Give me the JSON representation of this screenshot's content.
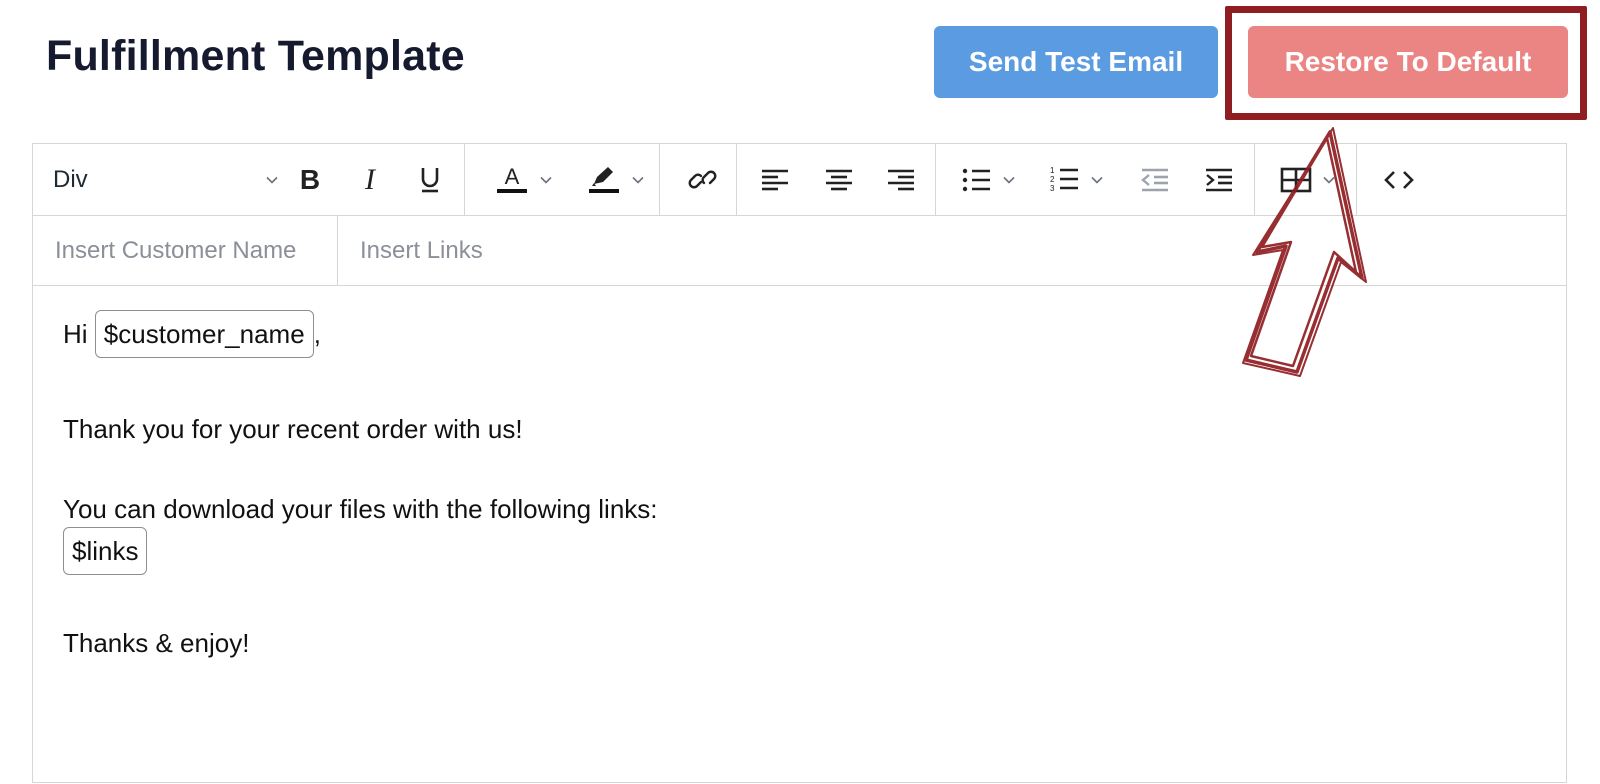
{
  "page": {
    "title": "Fulfillment Template"
  },
  "header_buttons": {
    "send_test_email": "Send Test Email",
    "restore_default": "Restore To Default"
  },
  "colors": {
    "send_button": "#5b9be1",
    "restore_button": "#eb8584",
    "annotation": "#8f1d21"
  },
  "toolbar": {
    "format_select_value": "Div",
    "icons": [
      "bold-icon",
      "italic-icon",
      "underline-icon",
      "text-color-icon",
      "highlight-color-icon",
      "link-icon",
      "align-left-icon",
      "align-center-icon",
      "align-right-icon",
      "bullet-list-icon",
      "numbered-list-icon",
      "outdent-icon",
      "indent-icon",
      "table-icon",
      "code-view-icon"
    ]
  },
  "insert_buttons": {
    "customer_name": "Insert Customer Name",
    "links": "Insert Links"
  },
  "editor_content": {
    "greeting_prefix": "Hi",
    "customer_token": "$customer_name",
    "greeting_suffix": ",",
    "line_thanks": "Thank you for your recent order with us!",
    "line_download": "You can download your files with the following links:",
    "links_token": "$links",
    "line_closing": "Thanks & enjoy!"
  }
}
